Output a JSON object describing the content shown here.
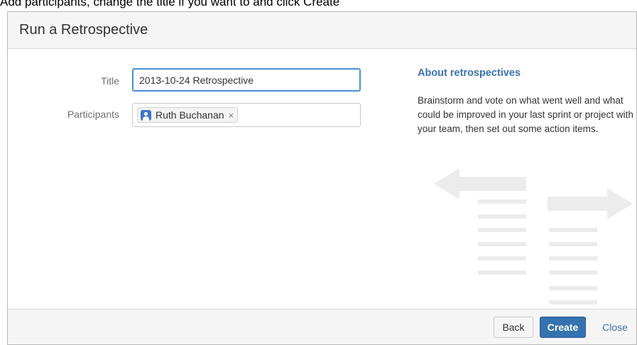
{
  "caption": "Add participants, change the title if you want to and click Create",
  "dialog": {
    "title": "Run a Retrospective"
  },
  "form": {
    "title_label": "Title",
    "title_value": "2013-10-24 Retrospective",
    "participants_label": "Participants",
    "participants": [
      {
        "name": "Ruth Buchanan",
        "remove_symbol": "×",
        "icon": "user-avatar-icon"
      }
    ]
  },
  "about": {
    "heading": "About retrospectives",
    "body": "Brainstorm and vote on what went well and what could be improved in your last sprint or project with your team, then set out some action items."
  },
  "footer": {
    "back_label": "Back",
    "create_label": "Create",
    "close_label": "Close"
  },
  "colors": {
    "accent": "#3572b0",
    "link": "#3b73af",
    "focus_border": "#4a90d9",
    "illustration": "#ececec"
  }
}
